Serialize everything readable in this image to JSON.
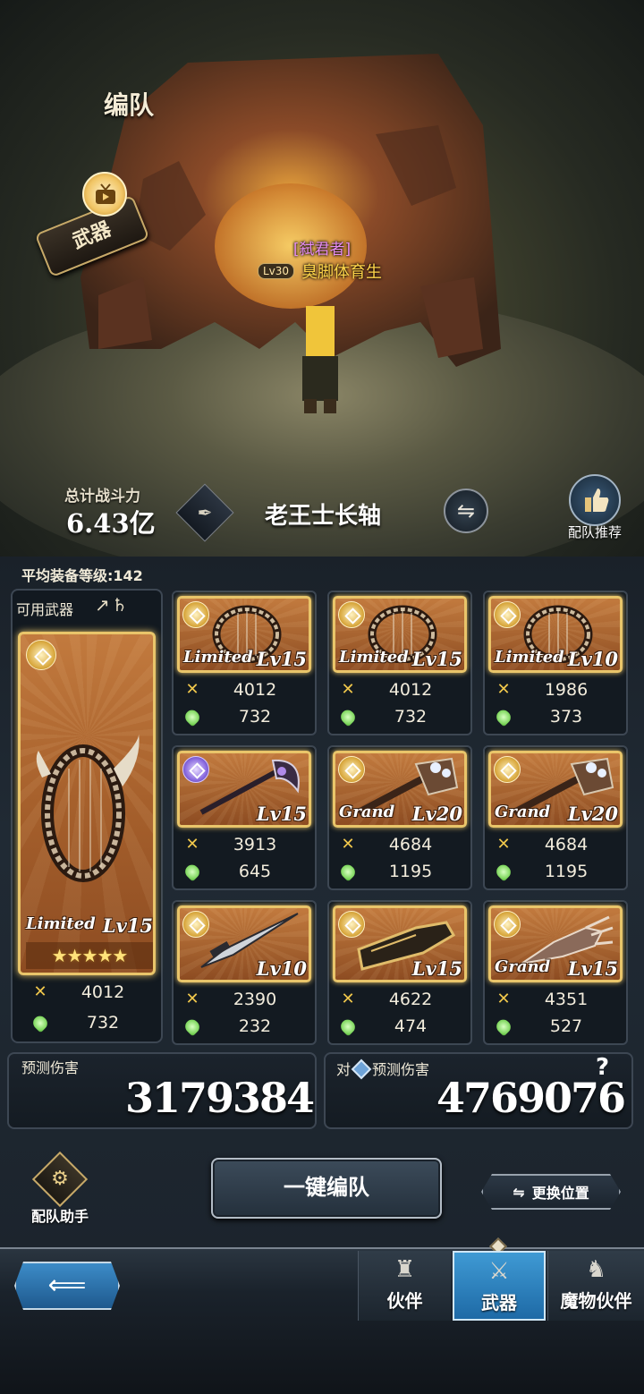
{
  "header": {
    "title": "编队"
  },
  "mode_badge": {
    "label": "武器",
    "icon": "video-icon"
  },
  "boss": {
    "title": "[弑君者]",
    "level": "Lv30",
    "name": "臭脚体育生"
  },
  "power": {
    "label": "总计战斗力",
    "value": "6.43亿"
  },
  "team": {
    "name": "老王士长轴"
  },
  "recommend": {
    "label": "配队推荐",
    "icon": "thumbs-up-icon"
  },
  "avg_level": "平均装备等级:142",
  "available": {
    "label": "可用武器",
    "icons": [
      "spear-icon",
      "harp-icon"
    ]
  },
  "main_weapon": {
    "type": "Limited",
    "level": "Lv15",
    "stars": 5,
    "star_glyphs": "★★★★★",
    "atk": "4012",
    "hp": "732"
  },
  "weapons": [
    {
      "type": "Limited",
      "level": "Lv15",
      "atk": "4012",
      "hp": "732",
      "art": "harp",
      "orb": "gold"
    },
    {
      "type": "Limited",
      "level": "Lv15",
      "atk": "4012",
      "hp": "732",
      "art": "harp",
      "orb": "gold"
    },
    {
      "type": "Limited",
      "level": "Lv10",
      "atk": "1986",
      "hp": "373",
      "art": "harp",
      "orb": "gold"
    },
    {
      "type": "",
      "level": "Lv15",
      "atk": "3913",
      "hp": "645",
      "art": "axe",
      "orb": "purple"
    },
    {
      "type": "Grand",
      "level": "Lv20",
      "atk": "4684",
      "hp": "1195",
      "art": "mace",
      "orb": "gold"
    },
    {
      "type": "Grand",
      "level": "Lv20",
      "atk": "4684",
      "hp": "1195",
      "art": "mace",
      "orb": "gold"
    },
    {
      "type": "",
      "level": "Lv10",
      "atk": "2390",
      "hp": "232",
      "art": "sword",
      "orb": "gold"
    },
    {
      "type": "",
      "level": "Lv15",
      "atk": "4622",
      "hp": "474",
      "art": "gauntlet",
      "orb": "gold"
    },
    {
      "type": "Grand",
      "level": "Lv15",
      "atk": "4351",
      "hp": "527",
      "art": "claw",
      "orb": "gold"
    }
  ],
  "damage": {
    "label": "预测伤害",
    "value": "3179384"
  },
  "damage_vs": {
    "prefix": "对",
    "label": "预测伤害",
    "value": "4769076",
    "help": "?"
  },
  "helper": {
    "label": "配队助手",
    "icon": "gear-icon"
  },
  "buttons": {
    "auto": "一键编队",
    "swap_position": "更换位置",
    "swap_icon": "⇋",
    "back_icon": "⟸"
  },
  "tabs": [
    {
      "label": "伙伴",
      "icon": "bust-icon",
      "active": false
    },
    {
      "label": "武器",
      "icon": "crossed-swords-icon",
      "active": true
    },
    {
      "label": "魔物伙伴",
      "icon": "dragon-icon",
      "active": false
    }
  ],
  "colors": {
    "accent": "#e9c56a",
    "card_bg": "#a6602c",
    "active_tab": "#3f9ad4",
    "boss_title": "#e68cf2",
    "boss_name": "#ffd54a"
  }
}
